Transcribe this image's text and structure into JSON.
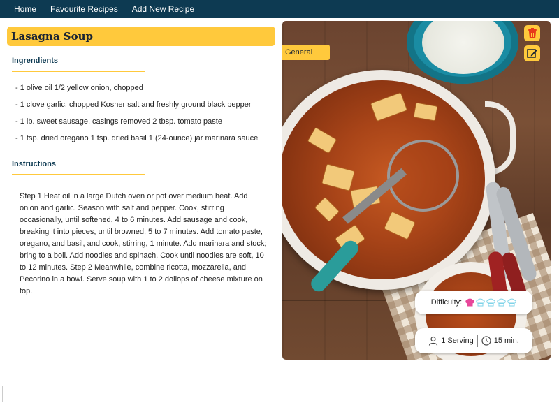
{
  "nav": {
    "items": [
      {
        "label": "Home"
      },
      {
        "label": "Favourite Recipes"
      },
      {
        "label": "Add New Recipe"
      }
    ]
  },
  "recipe": {
    "title": "Lasagna Soup",
    "category": "General",
    "ingredients_heading": "Ingrendients",
    "ingredients": [
      "- 1 olive oil 1/2 yellow onion, chopped",
      "- 1 clove garlic, chopped Kosher salt and freshly ground black pepper",
      "- 1 lb. sweet sausage, casings removed 2 tbsp. tomato paste",
      "- 1 tsp. dried oregano 1 tsp. dried basil 1 (24-ounce) jar marinara sauce"
    ],
    "instructions_heading": "Instructions",
    "instructions": "Step 1 Heat oil in a large Dutch oven or pot over medium heat. Add onion and garlic. Season with salt and pepper. Cook, stirring occasionally, until softened, 4 to 6 minutes. Add sausage and cook, breaking it into pieces, until browned, 5 to 7 minutes. Add tomato paste, oregano, and basil, and cook, stirring, 1 minute. Add marinara and stock; bring to a boil. Add noodles and spinach. Cook until noodles are soft, 10 to 12 minutes. Step 2 Meanwhile, combine ricotta, mozzarella, and Pecorino in a bowl. Serve soup with 1 to 2 dollops of cheese mixture on top.",
    "difficulty_label": "Difficulty:",
    "difficulty_level": 1,
    "difficulty_max": 5,
    "servings_text": "1 Serving",
    "time_text": "15 min."
  },
  "colors": {
    "nav_bg": "#0d3a52",
    "accent": "#ffc93c",
    "delete_icon": "#e8391a",
    "difficulty_active": "#e8479a",
    "difficulty_inactive": "#7fd3e8"
  },
  "icons": {
    "delete": "trash-icon",
    "edit": "edit-icon",
    "servings": "person-icon",
    "time": "clock-icon",
    "difficulty": "chef-hat-icon"
  }
}
